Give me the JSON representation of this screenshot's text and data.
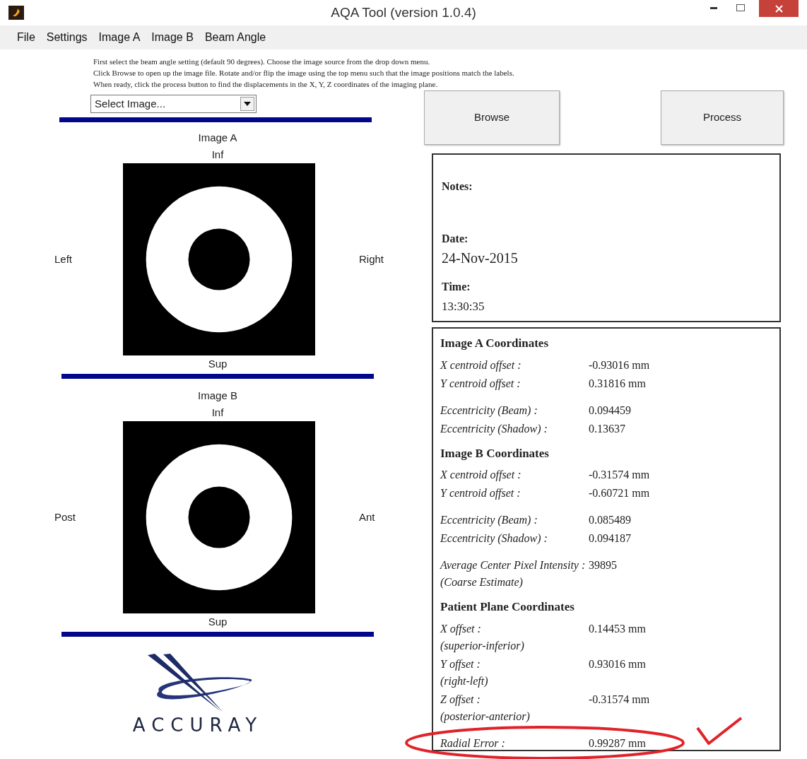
{
  "window": {
    "title": "AQA Tool (version 1.0.4)"
  },
  "menu": [
    "File",
    "Settings",
    "Image A",
    "Image B",
    "Beam Angle"
  ],
  "instructions": [
    "First select the beam angle setting (default 90 degrees). Choose the image source from the drop down menu.",
    "Click Browse to open up the image file. Rotate and/or flip the image using the top menu such that the image positions match the labels.",
    "When ready, click the process button to find the displacements in the X, Y, Z coordinates of the imaging plane."
  ],
  "image_source": {
    "value": "Select Image..."
  },
  "image_panels": [
    {
      "title": "Image A",
      "top": "Inf",
      "bottom": "Sup",
      "left": "Left",
      "right": "Right"
    },
    {
      "title": "Image B",
      "top": "Inf",
      "bottom": "Sup",
      "left": "Post",
      "right": "Ant"
    }
  ],
  "logo": {
    "text": "ACCURAY"
  },
  "buttons": [
    "Browse",
    "Process"
  ],
  "notes": {
    "notes_label": "Notes:",
    "date_label": "Date:",
    "date": "24-Nov-2015",
    "time_label": "Time:",
    "time": "13:30:35"
  },
  "results": [
    {
      "title": "Image A Coordinates",
      "groups": [
        [
          {
            "label": "X centroid  offset :",
            "value": "-0.93016 mm"
          },
          {
            "label": "Y centroid  offset :",
            "value": "0.31816 mm"
          }
        ],
        [
          {
            "label": "Eccentricity (Beam) :",
            "value": "0.094459"
          },
          {
            "label": "Eccentricity (Shadow) :",
            "value": "0.13637"
          }
        ]
      ]
    },
    {
      "title": "Image B Coordinates",
      "groups": [
        [
          {
            "label": "X centroid  offset :",
            "value": "-0.31574 mm"
          },
          {
            "label": "Y centroid  offset :",
            "value": "-0.60721 mm"
          }
        ],
        [
          {
            "label": "Eccentricity (Beam) :",
            "value": "0.085489"
          },
          {
            "label": "Eccentricity (Shadow) :",
            "value": "0.094187"
          }
        ],
        [
          {
            "label": "Average Center Pixel Intensity :",
            "sublabel": "(Coarse Estimate)",
            "value": "39895"
          }
        ]
      ]
    },
    {
      "title": "Patient Plane Coordinates",
      "groups": [
        [
          {
            "label": "X offset :",
            "sublabel": "(superior-inferior)",
            "value": "0.14453 mm"
          },
          {
            "label": "Y offset :",
            "sublabel": "(right-left)",
            "value": "0.93016 mm"
          },
          {
            "label": "Z offset :",
            "sublabel": "(posterior-anterior)",
            "value": "-0.31574 mm"
          }
        ],
        [
          {
            "label": "Radial Error :",
            "value": "0.99287 mm",
            "circled": true
          }
        ]
      ]
    }
  ],
  "check_mark": true
}
